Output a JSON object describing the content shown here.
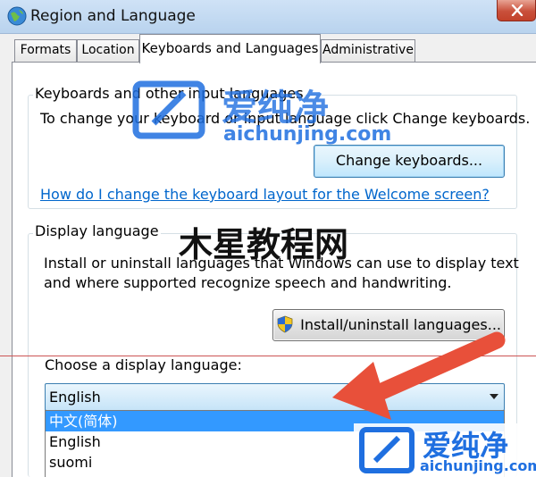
{
  "window": {
    "title": "Region and Language",
    "icon": "globe-icon",
    "close_icon": "close-icon"
  },
  "tabs": [
    {
      "label": "Formats",
      "active": false
    },
    {
      "label": "Location",
      "active": false
    },
    {
      "label": "Keyboards and Languages",
      "active": true
    },
    {
      "label": "Administrative",
      "active": false
    }
  ],
  "keyboards": {
    "group_title": "Keyboards and other input languages",
    "description": "To change your keyboard or input language click Change keyboards.",
    "button_label": "Change keyboards...",
    "welcome_link": "How do I change the keyboard layout for the Welcome screen?"
  },
  "display_language": {
    "group_title": "Display language",
    "description_line1": "Install or uninstall languages that Windows can use to display text",
    "description_line2": "and where supported recognize speech and handwriting.",
    "install_button_label": "Install/uninstall languages...",
    "install_button_icon": "uac-shield-icon",
    "choose_label": "Choose a display language:",
    "selected_value": "English",
    "options": [
      {
        "label": "中文(简体)",
        "selected": true
      },
      {
        "label": "English",
        "selected": false
      },
      {
        "label": "suomi",
        "selected": false
      }
    ]
  },
  "watermarks": {
    "site_name": "爱纯净",
    "site_url": "aichunjing.com",
    "site_name_2": "爱纯净",
    "site_url_2": "aichunjing.com",
    "tutorial_name": "木星教程网"
  },
  "colors": {
    "link": "#0066cc",
    "selection": "#3399ff",
    "watermark_blue": "#1f6fe0",
    "arrow_red": "#e8503a"
  }
}
